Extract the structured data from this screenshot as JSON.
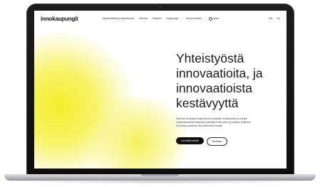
{
  "site": {
    "logo": "innokaupungit"
  },
  "nav": {
    "items": [
      {
        "label": "Ajankohtaista ja tapahtumat",
        "dropdown": false
      },
      {
        "label": "Teemat",
        "dropdown": false
      },
      {
        "label": "Palvelut",
        "dropdown": false
      },
      {
        "label": "Kaupungit",
        "dropdown": true
      },
      {
        "label": "Tietoa meistä",
        "dropdown": true
      }
    ],
    "search_label": "Haku",
    "languages": [
      "EN",
      "SV"
    ]
  },
  "hero": {
    "title_lines": [
      "Yhteistyöstä",
      "innovaatioita, ja",
      "innovaatioista",
      "kestävyyttä"
    ],
    "description": "Olemme olennaisia kaupunkimme yrityksille, instituutioille ja ihmisille mahdollistamalla kehitystä ja kehittää, kohti yhteen ja sitoutta. Pidämme Suomesta maailman innovaatiovintia maalta.",
    "primary_cta": "Lue lisää meistä",
    "secondary_cta": "Verkkaat"
  },
  "colors": {
    "accent_yellow": "#f4ee2c",
    "text_dark": "#1a1a1a",
    "button_dark": "#111111"
  }
}
